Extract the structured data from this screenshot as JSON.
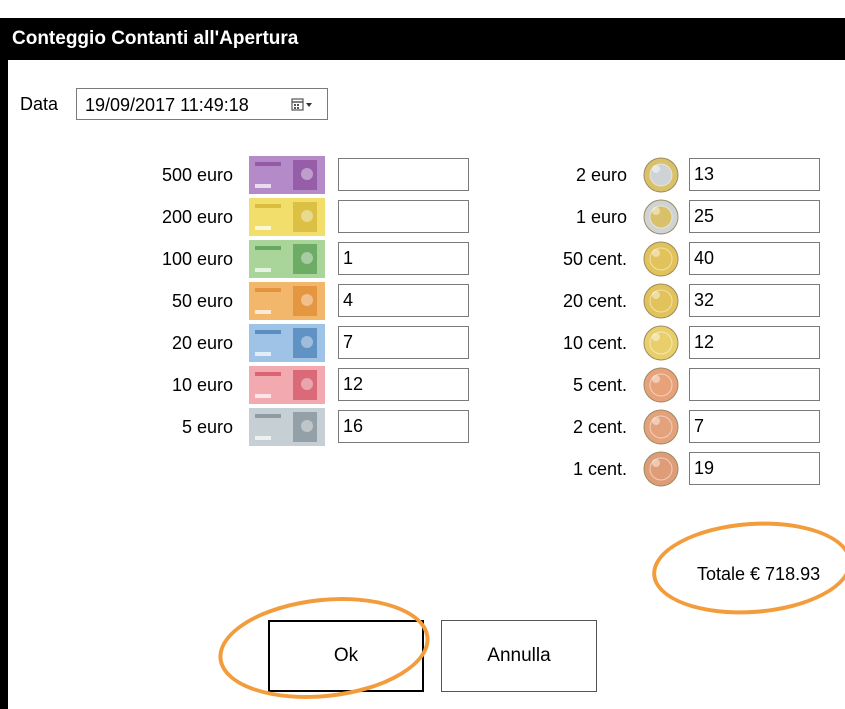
{
  "window": {
    "title": "Conteggio Contanti all'Apertura"
  },
  "date": {
    "label": "Data",
    "value": "19/09/2017 11:49:18"
  },
  "banknotes": [
    {
      "label": "500 euro",
      "value": "",
      "color": "#b48ac8",
      "accent": "#7d3b8f"
    },
    {
      "label": "200 euro",
      "value": "",
      "color": "#f2df6b",
      "accent": "#c9a622"
    },
    {
      "label": "100 euro",
      "value": "1",
      "color": "#a9d59a",
      "accent": "#3b8a3a"
    },
    {
      "label": "50 euro",
      "value": "4",
      "color": "#f3b76c",
      "accent": "#d97b1f"
    },
    {
      "label": "20 euro",
      "value": "7",
      "color": "#9ec3e6",
      "accent": "#2e6aa8"
    },
    {
      "label": "10 euro",
      "value": "12",
      "color": "#f2a9b0",
      "accent": "#c9374a"
    },
    {
      "label": "5 euro",
      "value": "16",
      "color": "#c6cfd4",
      "accent": "#6c7a82"
    }
  ],
  "coins": [
    {
      "label": "2 euro",
      "value": "13",
      "outer": "#d9c06a",
      "inner": "#cfd3d6",
      "icon": "coin-2-euro-icon"
    },
    {
      "label": "1 euro",
      "value": "25",
      "outer": "#cfd3d6",
      "inner": "#d9c06a",
      "icon": "coin-1-euro-icon"
    },
    {
      "label": "50 cent.",
      "value": "40",
      "outer": "#e2c25a",
      "inner": "#e2c25a",
      "icon": "coin-50-cent-icon"
    },
    {
      "label": "20 cent.",
      "value": "32",
      "outer": "#e2c25a",
      "inner": "#e2c25a",
      "icon": "coin-20-cent-icon"
    },
    {
      "label": "10 cent.",
      "value": "12",
      "outer": "#e8cf6c",
      "inner": "#e8cf6c",
      "icon": "coin-10-cent-icon"
    },
    {
      "label": "5 cent.",
      "value": "",
      "outer": "#e8a27a",
      "inner": "#e8a27a",
      "icon": "coin-5-cent-icon"
    },
    {
      "label": "2 cent.",
      "value": "7",
      "outer": "#e3a27c",
      "inner": "#e3a27c",
      "icon": "coin-2-cent-icon"
    },
    {
      "label": "1 cent.",
      "value": "19",
      "outer": "#df9d77",
      "inner": "#df9d77",
      "icon": "coin-1-cent-icon"
    }
  ],
  "total": {
    "text": "Totale € 718.93"
  },
  "buttons": {
    "ok": "Ok",
    "cancel": "Annulla"
  },
  "colors": {
    "title_bg": "#000000",
    "highlight_ring": "#f39c3b"
  }
}
